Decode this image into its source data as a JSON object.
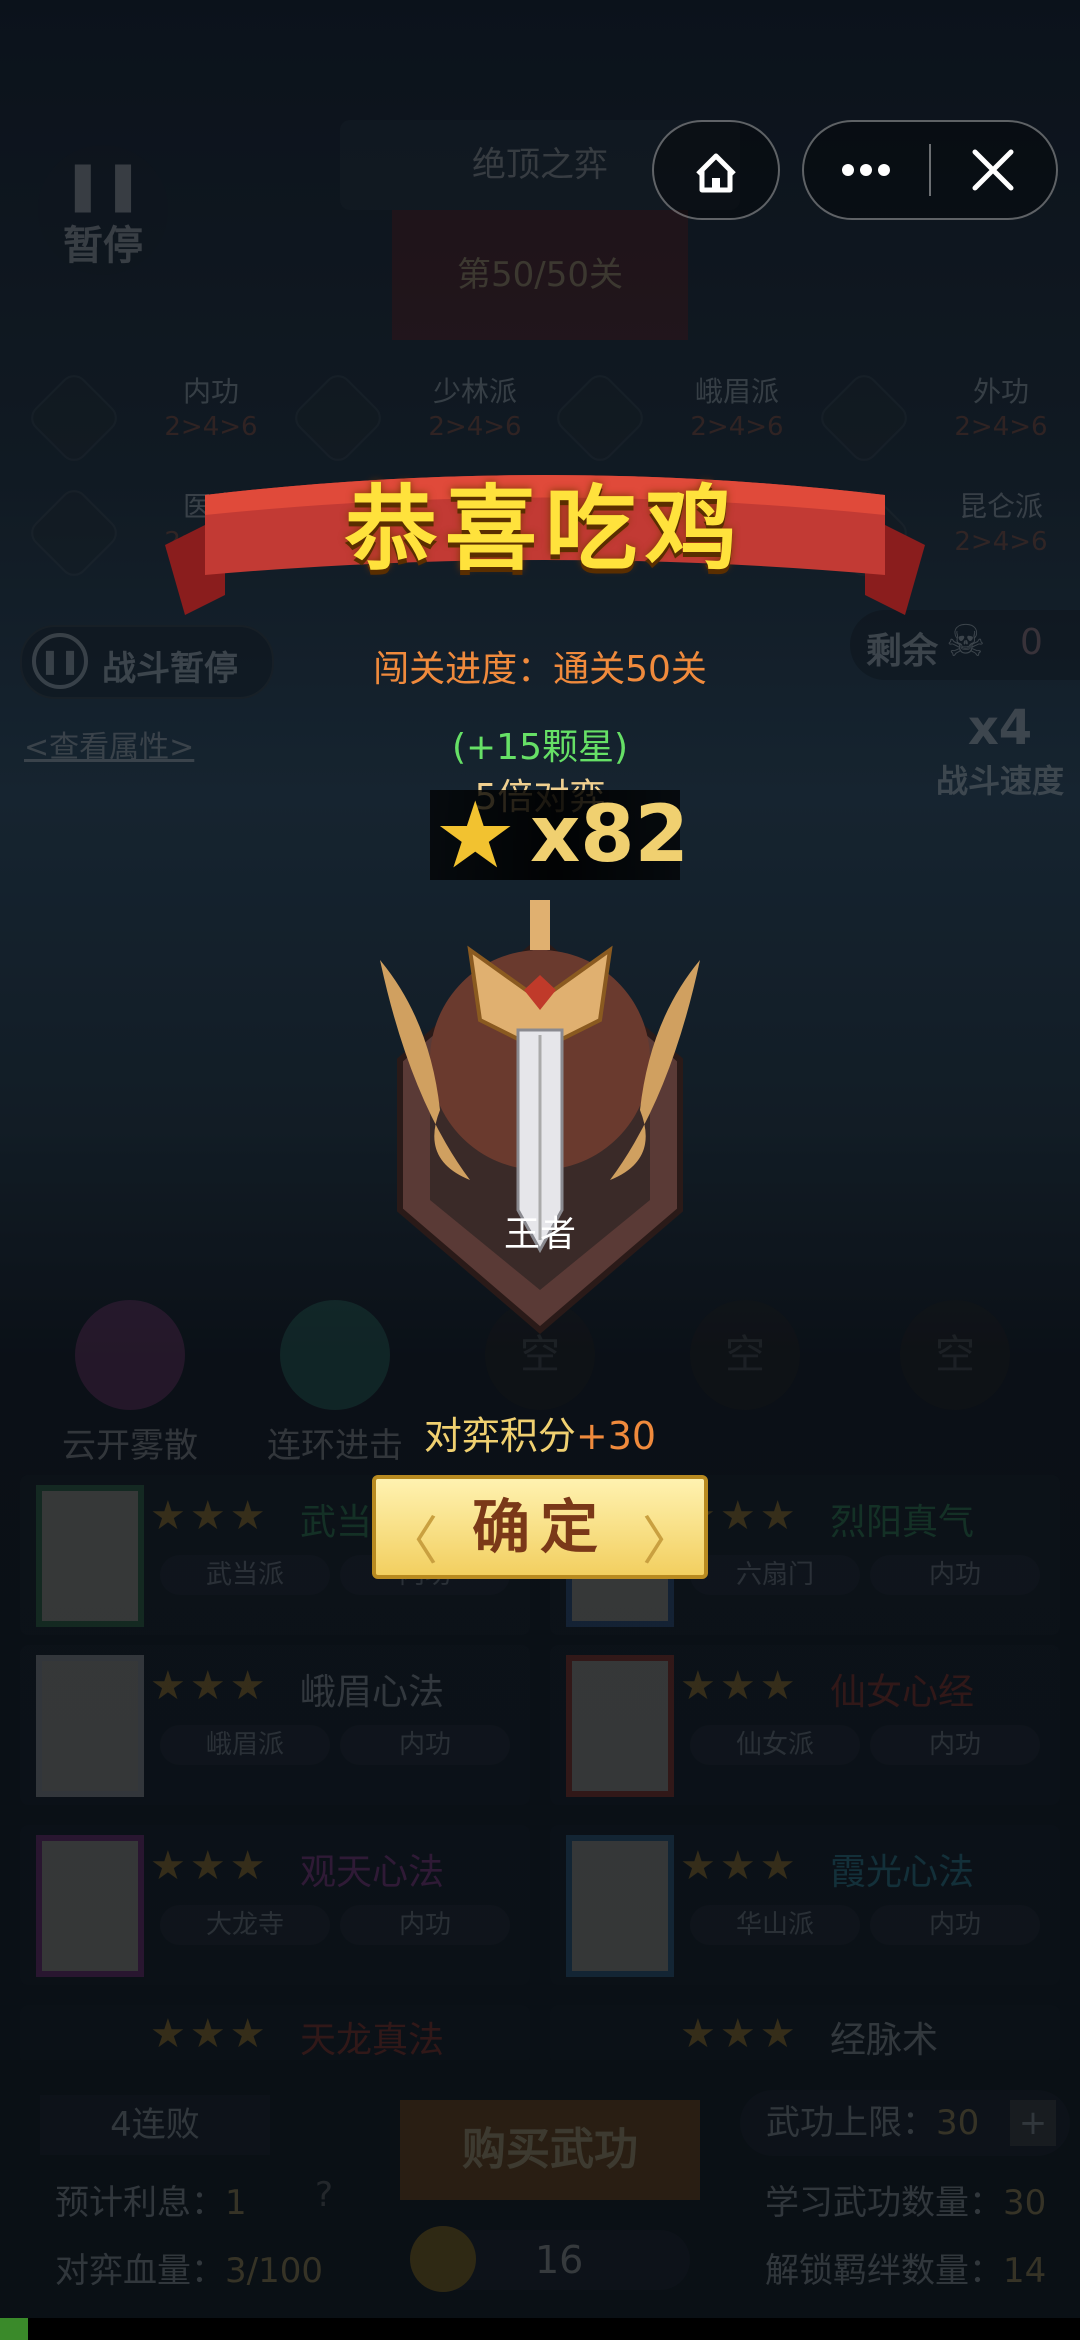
{
  "top": {
    "pause_label": "暂停",
    "level_name": "绝顶之弈",
    "level_progress": "第50/50关"
  },
  "skills": [
    {
      "name": "内功",
      "level": "2>4>6"
    },
    {
      "name": "少林派",
      "level": "2>4>6"
    },
    {
      "name": "峨眉派",
      "level": "2>4>6"
    },
    {
      "name": "外功",
      "level": "2>4>6"
    },
    {
      "name": "医术",
      "level": "2>4>6"
    },
    {
      "name": "昆仑派",
      "level": "2>4>6"
    }
  ],
  "battle": {
    "pause_battle": "战斗暂停",
    "remaining_label": "剩余",
    "remaining_count": "0",
    "view_attributes": "<查看属性>",
    "speed_multiplier": "x4",
    "speed_label": "战斗速度"
  },
  "result": {
    "title": "恭喜吃鸡",
    "progress_label": "闯关进度：",
    "progress_value": "通关50关",
    "star_bonus": "(+15颗星)",
    "multiplier_text": "5倍对弈",
    "star_count": "x82",
    "rank_name": "王者",
    "score_label": "对弈积分",
    "score_value": "+30",
    "confirm_label": "确定"
  },
  "abilities": [
    {
      "name": "云开雾散",
      "color": "#b85aa8"
    },
    {
      "name": "连环进击",
      "color": "#3a9a84"
    },
    {
      "name": "空",
      "color": "#555"
    },
    {
      "name": "空",
      "color": "#555"
    },
    {
      "name": "空",
      "color": "#555"
    }
  ],
  "cards": [
    {
      "title": "武当心法",
      "book": "武当心法",
      "tags": [
        "武当派",
        "内功"
      ],
      "title_color": "#3db36a",
      "border": "#3d8f5a"
    },
    {
      "title": "烈阳真气",
      "book": "烈阳真气",
      "tags": [
        "六扇门",
        "内功"
      ],
      "title_color": "#3db36a",
      "border": "#3d6fb0"
    },
    {
      "title": "峨眉心法",
      "book": "峨眉心法",
      "tags": [
        "峨眉派",
        "内功"
      ],
      "title_color": "#cfd6dc",
      "border": "#cfcfcf"
    },
    {
      "title": "仙女心经",
      "book": "仙女心经",
      "tags": [
        "仙女派",
        "内功"
      ],
      "title_color": "#c8402f",
      "border": "#c8402f"
    },
    {
      "title": "观天心法",
      "book": "观天心法",
      "tags": [
        "大龙寺",
        "内功"
      ],
      "title_color": "#c04ab8",
      "border": "#a03aa0"
    },
    {
      "title": "霞光心法",
      "book": "霞光心法",
      "tags": [
        "华山派",
        "内功"
      ],
      "title_color": "#3fb2c8",
      "border": "#3f7fb0"
    },
    {
      "title": "天龙真法",
      "book": "",
      "tags": [],
      "title_color": "#c8402f",
      "border": "#c8402f"
    },
    {
      "title": "经脉术",
      "book": "",
      "tags": [],
      "title_color": "#cfd6dc",
      "border": "#cfcfcf"
    }
  ],
  "footer": {
    "loss_streak": "4连败",
    "interest_label": "预计利息：",
    "interest_value": "1",
    "hp_label": "对弈血量：",
    "hp_value": "3/100",
    "buy_label": "购买武功",
    "coins": "16",
    "limit_label": "武功上限：",
    "limit_value": "30",
    "learned_label": "学习武功数量：",
    "learned_value": "30",
    "bonds_label": "解锁羁绊数量：",
    "bonds_value": "14"
  }
}
